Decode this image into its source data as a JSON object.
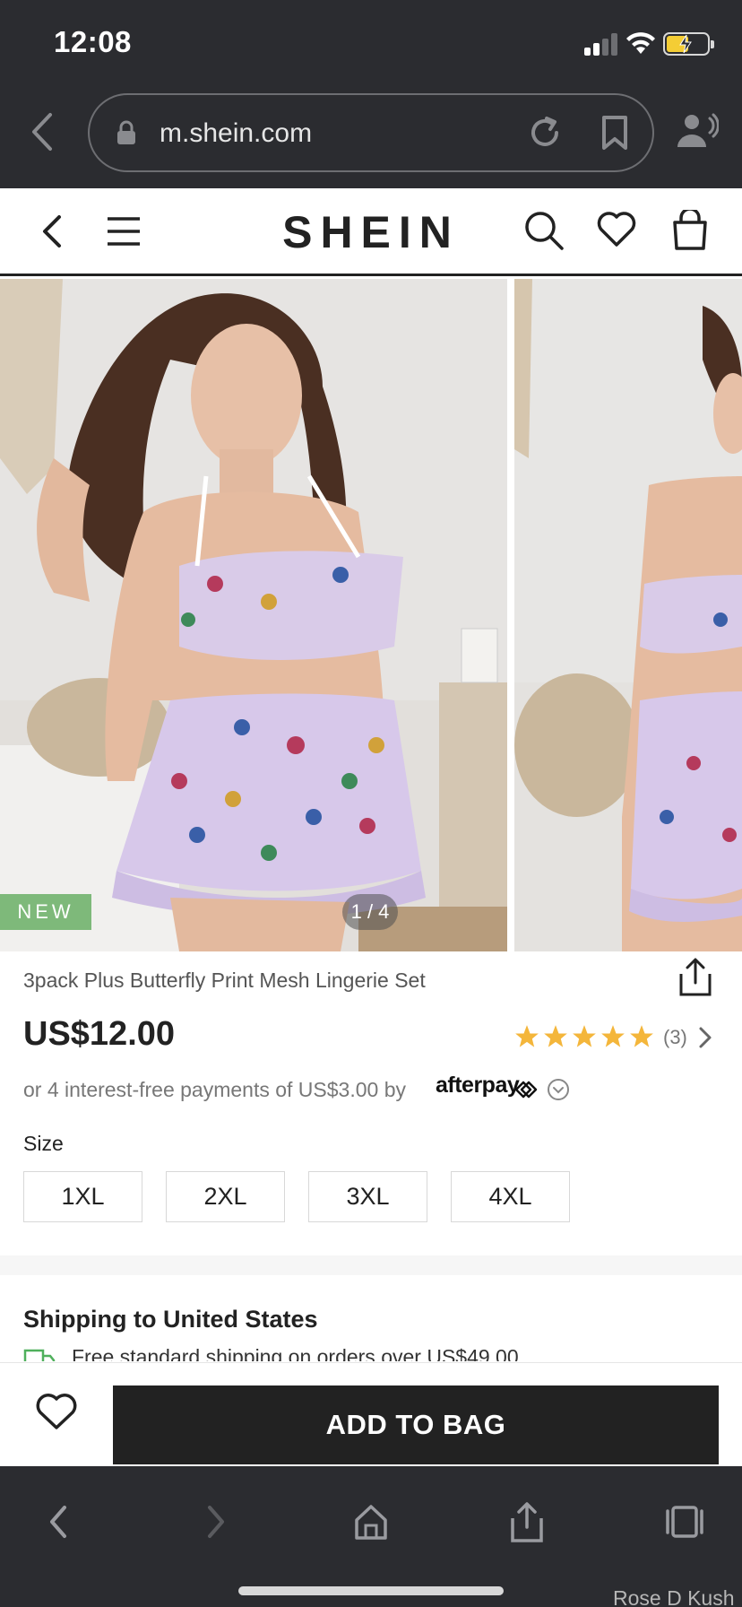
{
  "status_bar": {
    "time": "12:08"
  },
  "browser": {
    "url": "m.shein.com",
    "icons": [
      "back-icon",
      "lock-icon",
      "reload-icon",
      "bookmark-icon",
      "reader-icon"
    ]
  },
  "header": {
    "logo": "SHEIN",
    "icons": [
      "back-icon",
      "menu-icon",
      "search-icon",
      "heart-icon",
      "bag-icon"
    ]
  },
  "gallery": {
    "badge": "NEW",
    "counter": "1 / 4",
    "current_index": 1,
    "total_images": 4
  },
  "product": {
    "title": "3pack Plus Butterfly Print Mesh Lingerie Set",
    "price": "US$12.00",
    "rating": 5,
    "review_count": "(3)",
    "installments": "or 4 interest-free payments of US$3.00 by",
    "installment_provider": "afterpay",
    "size_label": "Size",
    "sizes": [
      "1XL",
      "2XL",
      "3XL",
      "4XL"
    ]
  },
  "shipping": {
    "title": "Shipping to United States",
    "text": "Free standard shipping on orders over US$49.00"
  },
  "actions": {
    "add_to_bag": "ADD TO BAG"
  },
  "colors": {
    "accent": "#222222",
    "new_badge": "#7eb97a",
    "star": "#f4b63b",
    "chrome": "#2b2c30"
  },
  "watermark": "Rose D Kush"
}
